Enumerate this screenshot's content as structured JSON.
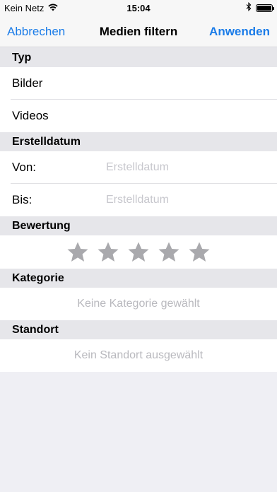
{
  "status_bar": {
    "carrier": "Kein Netz",
    "time": "15:04",
    "wifi_icon": "wifi-icon",
    "bluetooth_icon": "bluetooth-icon",
    "battery_icon": "battery-icon"
  },
  "nav": {
    "cancel_label": "Abbrechen",
    "title": "Medien filtern",
    "apply_label": "Anwenden",
    "accent_color": "#1b7ce8"
  },
  "sections": {
    "type": {
      "header": "Typ",
      "items": [
        "Bilder",
        "Videos"
      ]
    },
    "date": {
      "header": "Erstelldatum",
      "from_label": "Von:",
      "from_placeholder": "Erstelldatum",
      "to_label": "Bis:",
      "to_placeholder": "Erstelldatum"
    },
    "rating": {
      "header": "Bewertung",
      "stars_total": 5,
      "stars_selected": 0,
      "star_color": "#a9a9ad"
    },
    "category": {
      "header": "Kategorie",
      "value": "Keine Kategorie gewählt"
    },
    "location": {
      "header": "Standort",
      "value": "Kein Standort ausgewählt"
    }
  }
}
